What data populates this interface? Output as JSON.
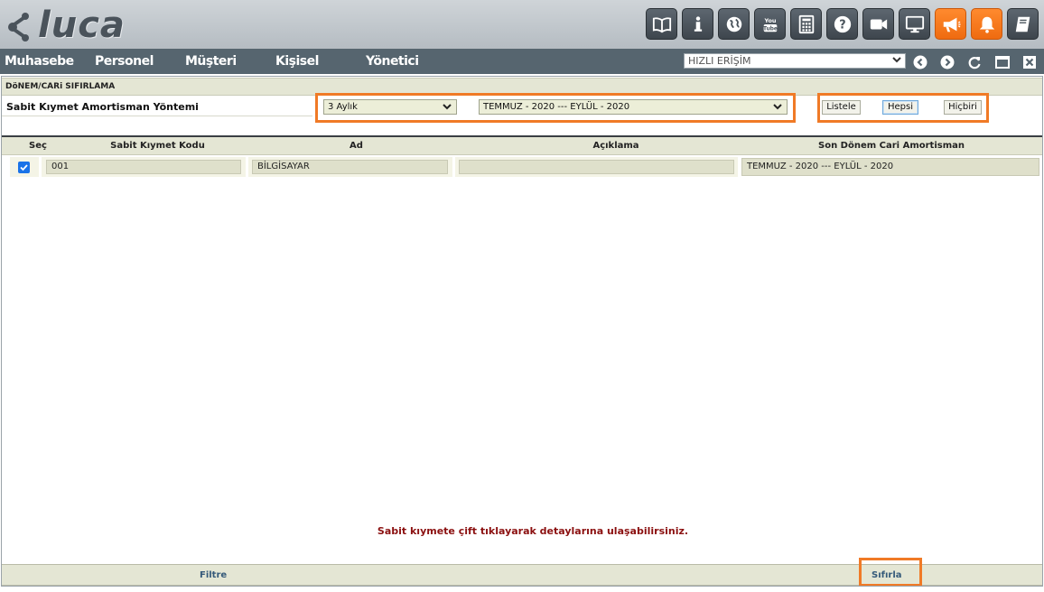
{
  "app": {
    "logo_text": "luca"
  },
  "toolbar_icons": [
    {
      "name": "book-open-icon",
      "color": "#4a545c"
    },
    {
      "name": "info-icon",
      "color": "#4a545c"
    },
    {
      "name": "globe-icon",
      "color": "#4a545c"
    },
    {
      "name": "youtube-icon",
      "color": "#4a545c"
    },
    {
      "name": "calculator-icon",
      "color": "#4a545c"
    },
    {
      "name": "help-icon",
      "color": "#4a545c"
    },
    {
      "name": "video-camera-icon",
      "color": "#4a545c"
    },
    {
      "name": "monitor-icon",
      "color": "#4a545c"
    },
    {
      "name": "megaphone-icon",
      "color": "#f47a20"
    },
    {
      "name": "bell-icon",
      "color": "#f47a20"
    },
    {
      "name": "notebook-icon",
      "color": "#4a545c"
    }
  ],
  "nav": {
    "items": [
      "Muhasebe",
      "Personel",
      "Müşteri",
      "Kişisel",
      "Yönetici"
    ],
    "quick_access": "HIZLI ERİŞİM"
  },
  "section": {
    "title": "DöNEM/CARi SIFIRLAMA",
    "method_label": "Sabit Kıymet Amortisman Yöntemi",
    "period_type": "3 Aylık",
    "period_range": "TEMMUZ - 2020 --- EYLÜL - 2020",
    "btn_list": "Listele",
    "btn_all": "Hepsi",
    "btn_none": "Hiçbiri"
  },
  "table": {
    "headers": {
      "select": "Seç",
      "code": "Sabit Kıymet Kodu",
      "name": "Ad",
      "desc": "Açıklama",
      "last_period": "Son Dönem Cari Amortisman"
    },
    "rows": [
      {
        "checked": true,
        "code": "001",
        "name": "BİLGİSAYAR",
        "desc": "",
        "last_period": "TEMMUZ - 2020 --- EYLÜL - 2020"
      }
    ]
  },
  "hint": "Sabit kıymete çift tıklayarak detaylarına ulaşabilirsiniz.",
  "footer": {
    "filter": "Filtre",
    "reset": "Sıfırla"
  },
  "colors": {
    "highlight": "#f07a26",
    "nav_bg": "#56656f",
    "panel_bg": "#e4e6d4",
    "hint_text": "#8b1010"
  }
}
